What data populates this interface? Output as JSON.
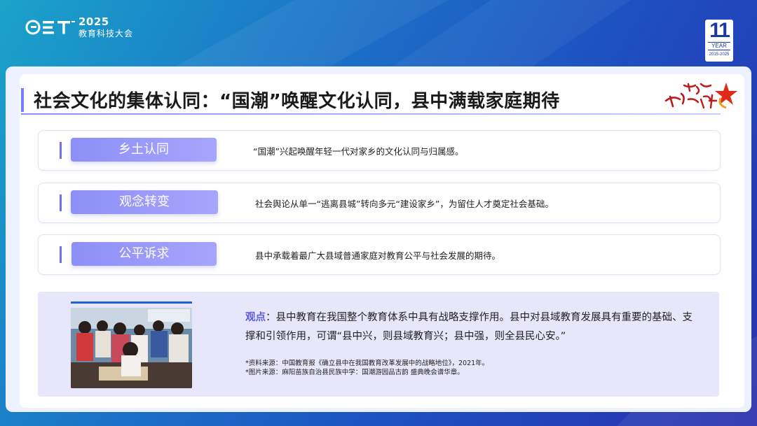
{
  "header": {
    "event_year": "2025",
    "event_name": "教育科技大会",
    "badge": {
      "number": "11",
      "label": "YEAR",
      "range": "2015-2025"
    }
  },
  "slide": {
    "title": "社会文化的集体认同：“国潮”唤醒文化认同，县中满载家庭期待",
    "slogan_image_text": "育人方针",
    "rows": [
      {
        "label": "乡土认同",
        "text": "“国潮”兴起唤醒年轻一代对家乡的文化认同与归属感。"
      },
      {
        "label": "观念转变",
        "text": "社会舆论从单一“逃离县城”转向多元“建设家乡”，为留住人才奠定社会基础。"
      },
      {
        "label": "公平诉求",
        "text": "县中承载着最广大县域普通家庭对教育公平与社会发展的期待。"
      }
    ],
    "point": {
      "key": "观点",
      "text": "：县中教育在我国整个教育体系中具有战略支撑作用。县中对县域教育发展具有重要的基础、支撑和引领作用，可谓“县中兴，则县域教育兴；县中强，则全县民心安。”"
    },
    "sources": [
      "*资料来源：中国教育报《确立县中在我国教育改革发展中的战略地位》，2021年。",
      "*图片来源：麻阳苗族自治县民族中学：国潮游园品古韵 盛典晚会谱华章。"
    ]
  },
  "colors": {
    "accent": "#7a7ff0",
    "label_gradient_start": "#8d8ff8",
    "key": "#5b5be0",
    "photo_bar": "#1e62d8"
  }
}
